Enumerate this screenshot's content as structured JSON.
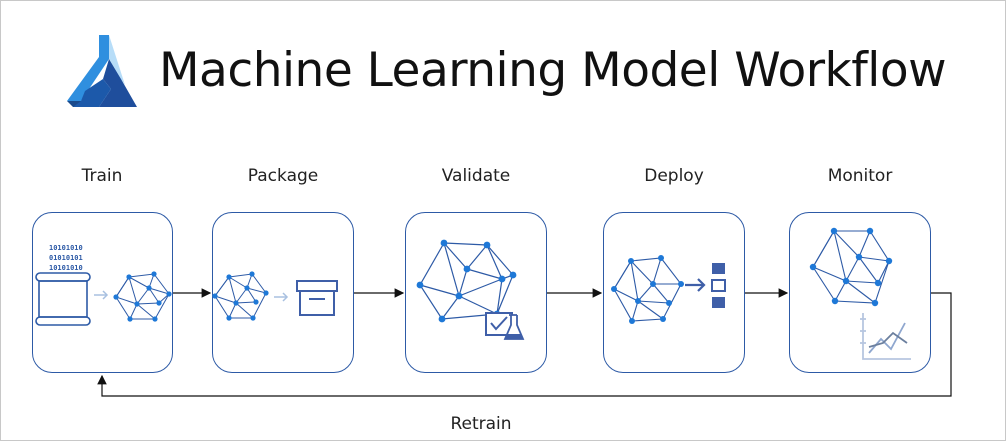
{
  "header": {
    "title": "Machine Learning Model Workflow",
    "logo_icon": "azure-machine-learning-icon"
  },
  "stages": [
    {
      "label": "Train",
      "icon": "training-data-to-model-icon"
    },
    {
      "label": "Package",
      "icon": "model-to-package-icon"
    },
    {
      "label": "Validate",
      "icon": "model-validation-icon"
    },
    {
      "label": "Deploy",
      "icon": "model-deploy-icon"
    },
    {
      "label": "Monitor",
      "icon": "model-monitor-icon"
    }
  ],
  "loop": {
    "label": "Retrain"
  },
  "colors": {
    "accent": "#2d5aa6",
    "node": "#1e78d7",
    "logo_light": "#3aa0e8",
    "logo_dark": "#1f4e9c",
    "arrow": "#111111"
  }
}
